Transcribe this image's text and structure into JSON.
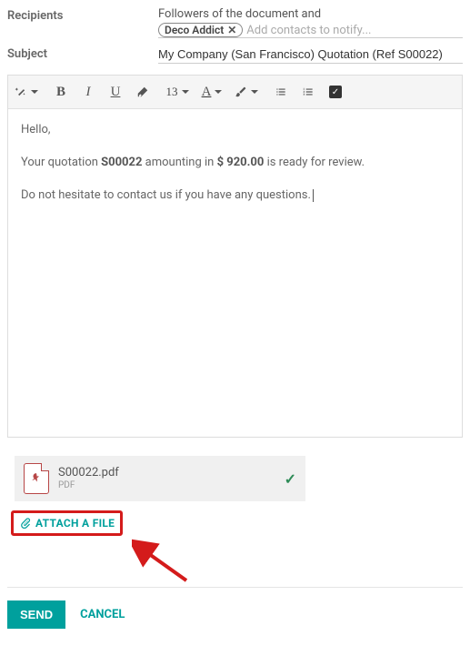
{
  "labels": {
    "recipients": "Recipients",
    "subject": "Subject"
  },
  "recipients": {
    "prefix": "Followers of the document and",
    "chip": "Deco Addict",
    "placeholder": "Add contacts to notify..."
  },
  "subject": "My Company (San Francisco) Quotation (Ref S00022)",
  "toolbar": {
    "font_size": "13",
    "color_letter": "A"
  },
  "body": {
    "hello": "Hello,",
    "p1a": "Your quotation ",
    "p1_ref": "S00022",
    "p1b": " amounting in ",
    "p1_amount": "$ 920.00",
    "p1c": " is ready for review.",
    "p2": "Do not hesitate to contact us if you have any questions."
  },
  "attachment": {
    "name": "S00022.pdf",
    "type": "PDF"
  },
  "actions": {
    "attach": "ATTACH A FILE",
    "send": "SEND",
    "cancel": "CANCEL"
  }
}
